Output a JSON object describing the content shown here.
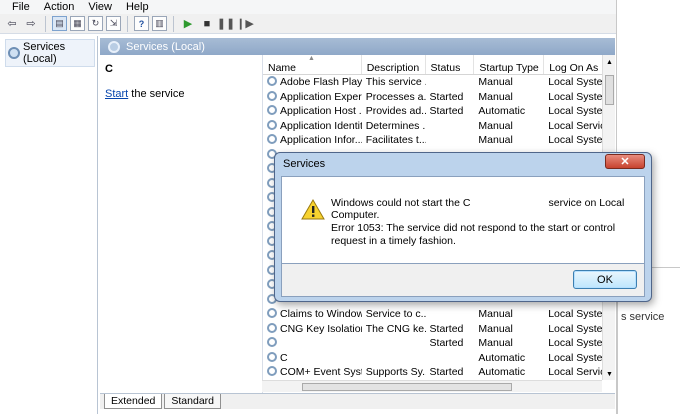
{
  "menu": [
    "File",
    "Action",
    "View",
    "Help"
  ],
  "tree": {
    "item": "Services (Local)"
  },
  "panel": {
    "title": "Services (Local)"
  },
  "detail": {
    "service_name": "C",
    "start_link": "Start",
    "start_rest": " the service"
  },
  "columns": [
    "Name",
    "Description",
    "Status",
    "Startup Type",
    "Log On As"
  ],
  "rows": [
    [
      "Adobe Flash Playe...",
      "This service ...",
      "",
      "Manual",
      "Local Syste..."
    ],
    [
      "Application Experi...",
      "Processes a...",
      "Started",
      "Manual",
      "Local Syste..."
    ],
    [
      "Application Host ...",
      "Provides ad...",
      "Started",
      "Automatic",
      "Local Syste..."
    ],
    [
      "Application Identity",
      "Determines ...",
      "",
      "Manual",
      "Local Service"
    ],
    [
      "Application Infor...",
      "Facilitates t...",
      "",
      "Manual",
      "Local Syste..."
    ],
    [
      "",
      "",
      "",
      "",
      ""
    ],
    [
      "",
      "",
      "",
      "",
      ""
    ],
    [
      "",
      "",
      "",
      "",
      ""
    ],
    [
      "",
      "",
      "",
      "",
      ""
    ],
    [
      "",
      "",
      "",
      "",
      ""
    ],
    [
      "",
      "",
      "",
      "",
      ""
    ],
    [
      "",
      "",
      "",
      "",
      ""
    ],
    [
      "",
      "",
      "",
      "",
      ""
    ],
    [
      "",
      "",
      "",
      "",
      ""
    ],
    [
      "",
      "",
      "",
      "",
      ""
    ],
    [
      "",
      "",
      "",
      "",
      ""
    ],
    [
      "Claims to Window...",
      "Service to c...",
      "",
      "Manual",
      "Local Syste..."
    ],
    [
      "CNG Key Isolation",
      "The CNG ke...",
      "Started",
      "Manual",
      "Local Syste..."
    ],
    [
      "",
      "",
      "Started",
      "Manual",
      "Local Syste..."
    ],
    [
      "C",
      "",
      "",
      "Automatic",
      "Local Syste..."
    ],
    [
      "COM+ Event Syst...",
      "Supports Sy...",
      "Started",
      "Automatic",
      "Local Service"
    ]
  ],
  "tabs": [
    "Extended",
    "Standard"
  ],
  "right_fragment": "s service",
  "dialog": {
    "title": "Services",
    "close": "✕",
    "line1_a": "Windows could not start the C",
    "line1_b": "service on Local Computer.",
    "line2": "Error 1053: The service did not respond to the start or control request in a timely fashion.",
    "ok": "OK"
  }
}
